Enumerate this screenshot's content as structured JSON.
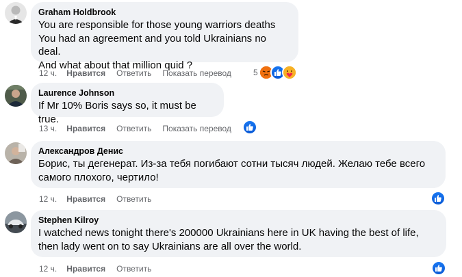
{
  "comments": [
    {
      "author": "Graham Holdbrook",
      "lines": [
        "You are responsible for those young warriors deaths",
        "You had an agreement and you told Ukrainians no deal.",
        "And what about that million quid ?"
      ],
      "time": "12 ч.",
      "like": "Нравится",
      "reply": "Ответить",
      "translate": "Показать перевод",
      "reaction_count": "5",
      "reactions": [
        "angry-icon",
        "like-icon",
        "care-icon"
      ]
    },
    {
      "author": "Laurence Johnson",
      "lines": [
        "If Mr 10% Boris says so, it must be true."
      ],
      "time": "13 ч.",
      "like": "Нравится",
      "reply": "Ответить",
      "translate": "Показать перевод",
      "reactions": [
        "like-icon"
      ]
    },
    {
      "author": "Александров Денис",
      "lines": [
        "Борис, ты дегенерат. Из-за тебя погибают сотни тысяч людей. Желаю тебе всего",
        "самого плохого, чертило!"
      ],
      "time": "12 ч.",
      "like": "Нравится",
      "reply": "Ответить",
      "reactions": [
        "like-icon"
      ]
    },
    {
      "author": "Stephen Kilroy",
      "lines": [
        "I watched news tonight there's 200000 Ukrainians here in UK having the best of life,",
        "then lady went on to say Ukrainians are all over the world."
      ],
      "time": "12 ч.",
      "like": "Нравится",
      "reply": "Ответить",
      "reactions": [
        "like-icon"
      ]
    }
  ],
  "colors": {
    "bubble": "#f0f2f5",
    "meta_text": "#65676b",
    "like_blue": "#1877f2",
    "angry": "#e9710f",
    "care": "#f7b125"
  }
}
